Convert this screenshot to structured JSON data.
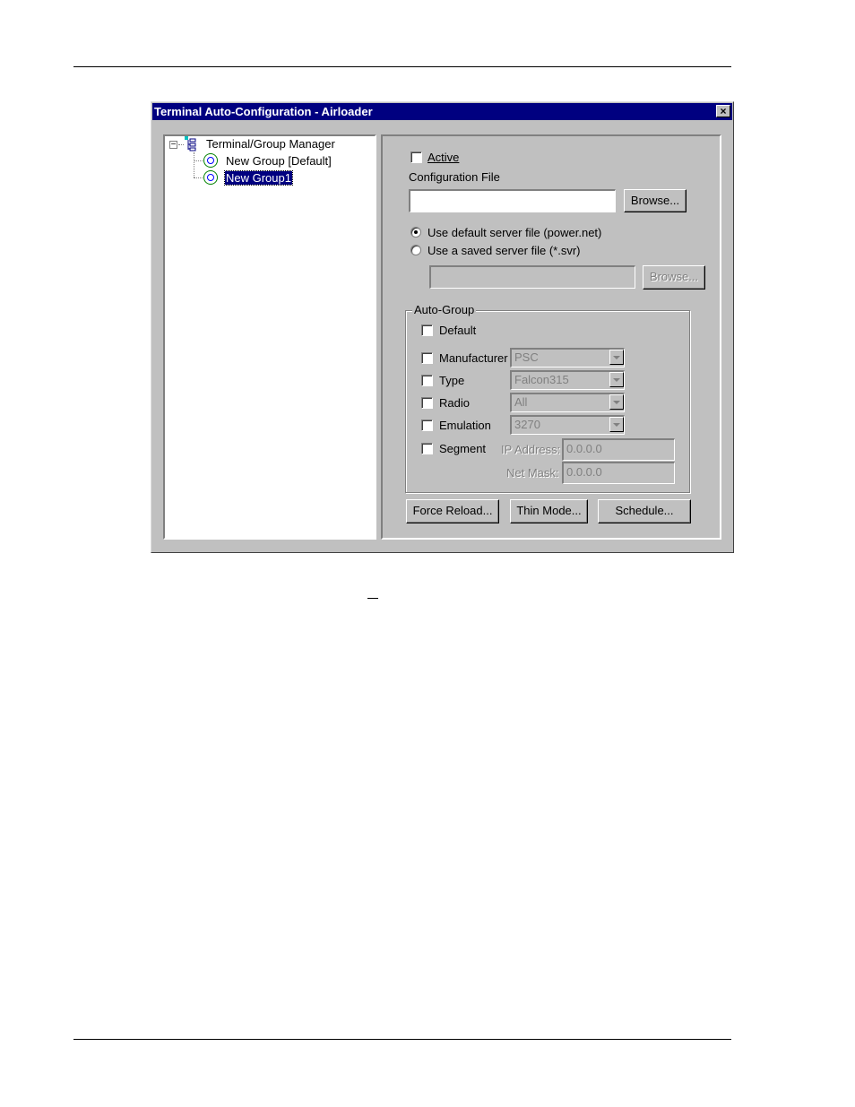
{
  "window": {
    "title": "Terminal Auto-Configuration - Airloader",
    "close_glyph": "×"
  },
  "tree": {
    "root": "Terminal/Group Manager",
    "expander": "−",
    "children": [
      {
        "label": "New Group [Default]",
        "selected": false
      },
      {
        "label": "New Group1",
        "selected": true
      }
    ]
  },
  "panel": {
    "active_label": "Active",
    "config_file_label": "Configuration File",
    "config_file_value": "",
    "browse_label": "Browse...",
    "radio_default": "Use default server file (power.net)",
    "radio_saved": "Use a saved server file (*.svr)",
    "saved_file_value": "",
    "browse_disabled_label": "Browse...",
    "auto_group": {
      "legend": "Auto-Group",
      "default_label": "Default",
      "manufacturer_label": "Manufacturer",
      "manufacturer_value": "PSC",
      "type_label": "Type",
      "type_value": "Falcon315",
      "radio_label": "Radio",
      "radio_value": "All",
      "emulation_label": "Emulation",
      "emulation_value": "3270",
      "segment_label": "Segment",
      "ip_label": "IP Address:",
      "ip_value": "0.0.0.0",
      "mask_label": "Net Mask:",
      "mask_value": "0.0.0.0"
    },
    "force_reload": "Force Reload...",
    "thin_mode": "Thin Mode...",
    "schedule": "Schedule..."
  }
}
